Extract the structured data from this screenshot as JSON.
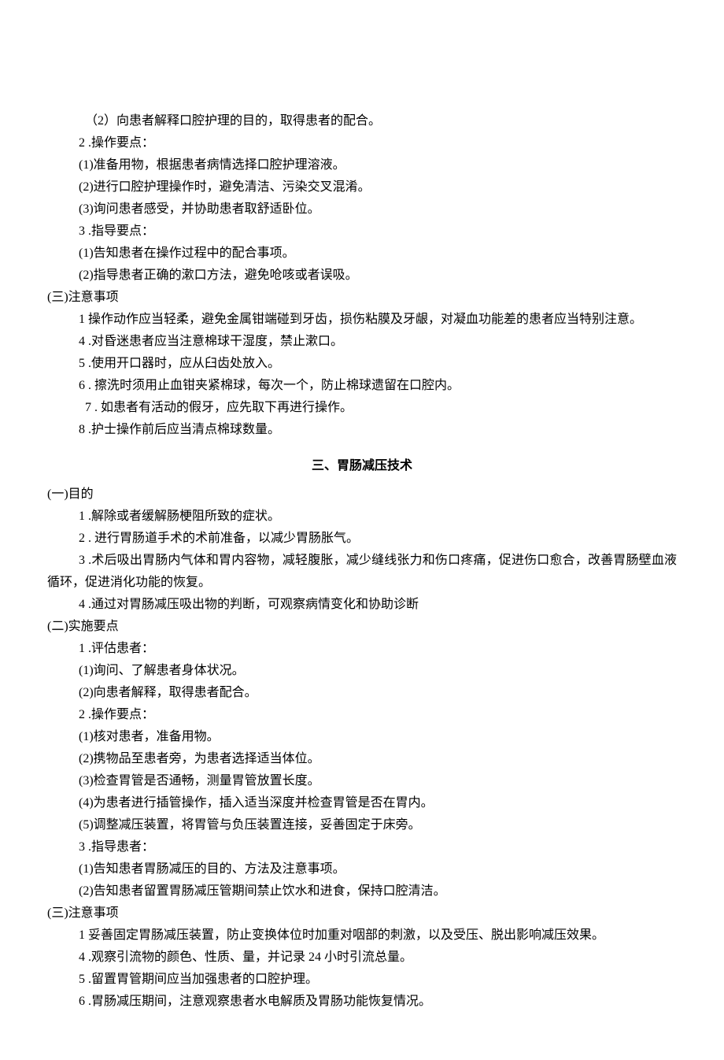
{
  "lines": {
    "l01": "（2）向患者解释口腔护理的目的，取得患者的配合。",
    "l02": "2  .操作要点：",
    "l03": "(1)准备用物，根据患者病情选择口腔护理溶液。",
    "l04": "(2)进行口腔护理操作时，避免清洁、污染交叉混淆。",
    "l05": "(3)询问患者感受，并协助患者取舒适卧位。",
    "l06": "3  .指导要点：",
    "l07": "(1)告知患者在操作过程中的配合事项。",
    "l08": "(2)指导患者正确的漱口方法，避免呛咳或者误吸。",
    "h3": "(三)注意事项",
    "l09": "1 操作动作应当轻柔，避免金属钳端碰到牙齿，损伤粘膜及牙龈，对凝血功能差的患者应当特别注意。",
    "l10": "4  .对昏迷患者应当注意棉球干湿度，禁止漱口。",
    "l11": "5  .使用开口器时，应从臼齿处放入。",
    "l12": "6  . 擦洗时须用止血钳夹紧棉球，每次一个，防止棉球遗留在口腔内。",
    "l13": "7  . 如患者有活动的假牙，应先取下再进行操作。",
    "l14": "8  .护士操作前后应当清点棉球数量。",
    "title2": "三、胃肠减压技术",
    "h1b": "(一)目的",
    "l15": "1  .解除或者缓解肠梗阻所致的症状。",
    "l16": "2  . 进行胃肠道手术的术前准备，以减少胃肠胀气。",
    "l17": "3  .术后吸出胃肠内气体和胃内容物，减轻腹胀，减少缝线张力和伤口疼痛，促进伤口愈合，改善胃肠壁血液循环，促进消化功能的恢复。",
    "l18": "4  .通过对胃肠减压吸出物的判断，可观察病情变化和协助诊断",
    "h2b": "(二)实施要点",
    "l19": "1  .评估患者：",
    "l20": "(1)询问、了解患者身体状况。",
    "l21": "(2)向患者解释，取得患者配合。",
    "l22": "2  .操作要点：",
    "l23": "(1)核对患者，准备用物。",
    "l24": "(2)携物品至患者旁，为患者选择适当体位。",
    "l25": "(3)检查胃管是否通畅，测量胃管放置长度。",
    "l26": "(4)为患者进行插管操作，插入适当深度并检查胃管是否在胃内。",
    "l27": "(5)调整减压装置，将胃管与负压装置连接，妥善固定于床旁。",
    "l28": "3  .指导患者：",
    "l29": "(1)告知患者胃肠减压的目的、方法及注意事项。",
    "l30": "(2)告知患者留置胃肠减压管期间禁止饮水和进食，保持口腔清洁。",
    "h3b": "(三)注意事项",
    "l31": "1 妥善固定胃肠减压装置，防止变换体位时加重对咽部的刺激，以及受压、脱出影响减压效果。",
    "l32": "4  .观察引流物的颜色、性质、量，并记录 24 小时引流总量。",
    "l33": "5  .留置胃管期间应当加强患者的口腔护理。",
    "l34": "6  .胃肠减压期间，注意观察患者水电解质及胃肠功能恢复情况。"
  }
}
